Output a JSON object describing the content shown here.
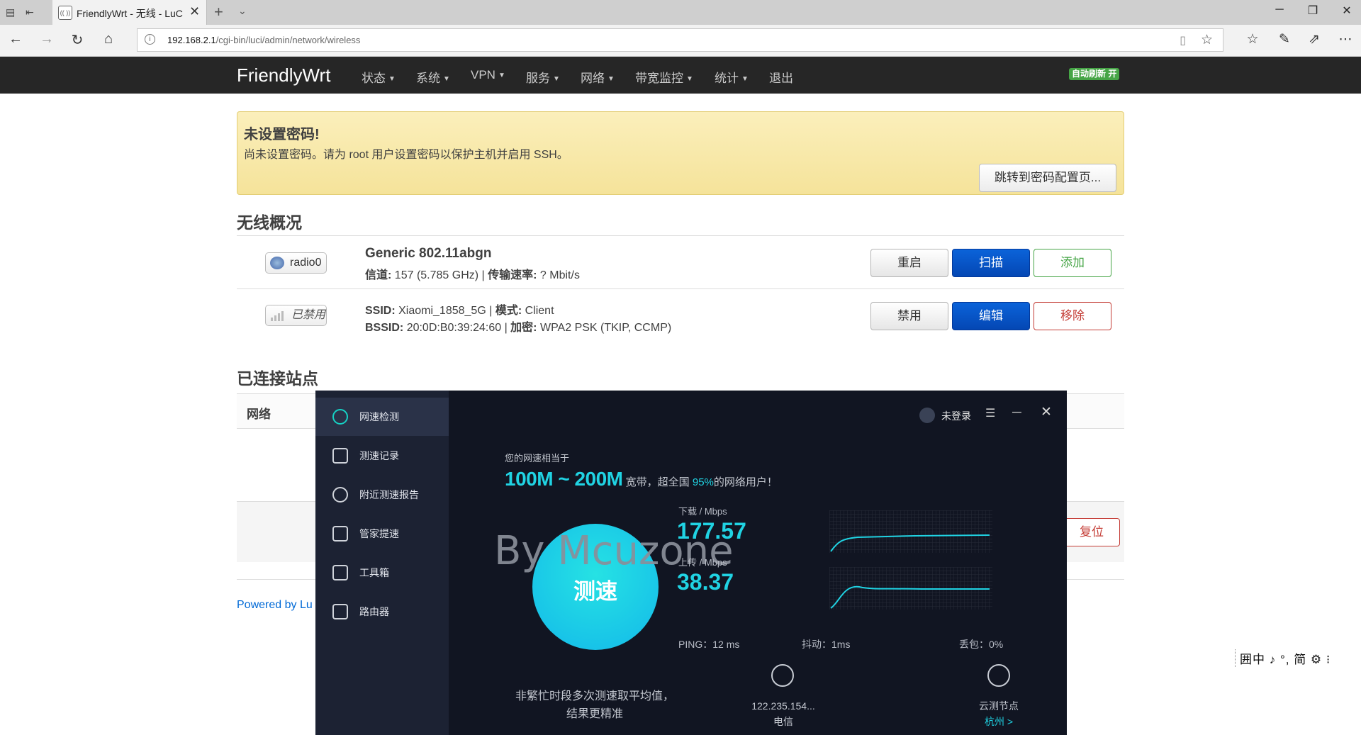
{
  "browser": {
    "tab_title": "FriendlyWrt - 无线 - LuC",
    "favicon_text": "(( ))",
    "url_host": "192.168.2.1",
    "url_path": "/cgi-bin/luci/admin/network/wireless"
  },
  "luci": {
    "brand": "FriendlyWrt",
    "menu": [
      "状态",
      "系统",
      "VPN",
      "服务",
      "网络",
      "带宽监控",
      "统计",
      "退出"
    ],
    "auto_refresh": "自动刷新 开",
    "alert": {
      "title": "未设置密码!",
      "text": "尚未设置密码。请为 root 用户设置密码以保护主机并启用 SSH。",
      "button": "跳转到密码配置页..."
    },
    "wireless_overview_title": "无线概况",
    "radio": {
      "badge": "radio0",
      "name": "Generic 802.11abgn",
      "channel_label": "信道:",
      "channel_value": "157 (5.785 GHz)",
      "rate_label": "传输速率:",
      "rate_value": "? Mbit/s",
      "buttons": {
        "restart": "重启",
        "scan": "扫描",
        "add": "添加"
      }
    },
    "network": {
      "badge": "已禁用",
      "ssid_label": "SSID:",
      "ssid_value": "Xiaomi_1858_5G",
      "mode_label": "模式:",
      "mode_value": "Client",
      "bssid_label": "BSSID:",
      "bssid_value": "20:0D:B0:39:24:60",
      "enc_label": "加密:",
      "enc_value": "WPA2 PSK (TKIP, CCMP)",
      "buttons": {
        "disable": "禁用",
        "edit": "编辑",
        "remove": "移除"
      }
    },
    "connected_title": "已连接站点",
    "table_header_network": "网络",
    "reset_button": "复位",
    "powered_by": "Powered by Lu"
  },
  "ime_bar": "囲中 ♪ °, 简 ⚙ ⁝",
  "speedtest": {
    "sidebar": [
      "网速检测",
      "测速记录",
      "附近测速报告",
      "管家提速",
      "工具箱",
      "路由器"
    ],
    "user": "未登录",
    "equiv_label": "您的网速相当于",
    "range": "100M ~ 200M",
    "headline_mid": "宽带，超全国",
    "percent": "95%",
    "headline_end": "的网络用户！",
    "watermark": "By Mcuzone",
    "start_button": "测速",
    "hint": "非繁忙时段多次测速取平均值，结果更精准",
    "download_label": "下载 / Mbps",
    "download_value": "177.57",
    "upload_label": "上传 / Mbps",
    "upload_value": "38.37",
    "ping": "PING：12 ms",
    "jitter": "抖动：1ms",
    "loss": "丢包：0%",
    "ip": "122.235.154...",
    "isp": "电信",
    "node_label": "云测节点",
    "node_city": "杭州 >",
    "accent": "#20d3e3"
  }
}
